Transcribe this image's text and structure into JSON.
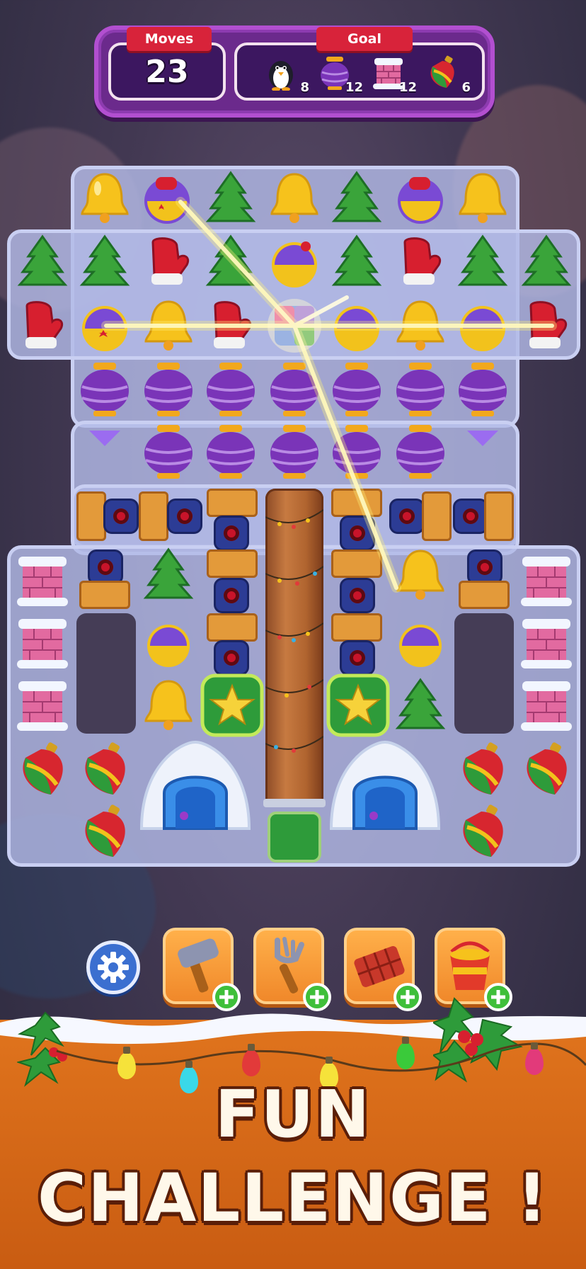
{
  "hud": {
    "moves_label": "Moves",
    "moves_value": "23",
    "goal_label": "Goal",
    "goals": [
      {
        "icon": "penguin-icon",
        "count": "8"
      },
      {
        "icon": "vase-icon",
        "count": "12"
      },
      {
        "icon": "chimney-icon",
        "count": "12"
      },
      {
        "icon": "ornament-icon",
        "count": "6"
      }
    ]
  },
  "boosters": [
    {
      "icon": "hammer-icon"
    },
    {
      "icon": "fork-icon"
    },
    {
      "icon": "chocolate-bar-icon"
    },
    {
      "icon": "bucket-icon"
    }
  ],
  "promo": {
    "line1": "FUN",
    "line2": "CHALLENGE !"
  },
  "colors": {
    "hud_purple": "#6b2a8c",
    "ribbon_red": "#d8233a",
    "banner_orange": "#e0741d",
    "booster_orange": "#f0882a"
  }
}
